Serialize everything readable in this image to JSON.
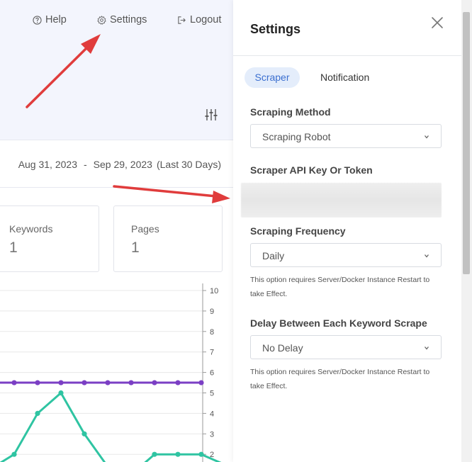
{
  "header": {
    "help_label": "Help",
    "settings_label": "Settings",
    "logout_label": "Logout"
  },
  "date_range": {
    "start": "Aug 31, 2023",
    "separator": "-",
    "end": "Sep 29, 2023",
    "label": "(Last 30 Days)"
  },
  "stats": [
    {
      "title": "Keywords",
      "value": "1"
    },
    {
      "title": "Pages",
      "value": "1"
    }
  ],
  "chart_data": {
    "type": "line",
    "y_ticks": [
      "10",
      "9",
      "8",
      "7",
      "6",
      "5",
      "4",
      "3",
      "2"
    ],
    "ylim": [
      0,
      10
    ],
    "grid": true,
    "series": [
      {
        "color": "#7b3fc4",
        "values": [
          5.5,
          5.5,
          5.5,
          5.5,
          5.5,
          5.5,
          5.5,
          5.5,
          5.5,
          5.5
        ]
      },
      {
        "color": "#2fc4a2",
        "values": [
          1.3,
          2.0,
          4.0,
          5.0,
          3.0,
          1.4,
          1.0,
          2.0,
          2.0,
          2.0,
          1.5
        ]
      }
    ]
  },
  "settings": {
    "title": "Settings",
    "tabs": [
      "Scraper",
      "Notification"
    ],
    "scraping_method": {
      "label": "Scraping Method",
      "value": "Scraping Robot"
    },
    "api_key": {
      "label": "Scraper API Key Or Token"
    },
    "frequency": {
      "label": "Scraping Frequency",
      "value": "Daily",
      "note": "This option requires Server/Docker Instance Restart to take Effect."
    },
    "delay": {
      "label": "Delay Between Each Keyword Scrape",
      "value": "No Delay",
      "note": "This option requires Server/Docker Instance Restart to take Effect."
    }
  },
  "colors": {
    "accent": "#3b6fd0",
    "annotation_arrow": "#e03c3c"
  }
}
